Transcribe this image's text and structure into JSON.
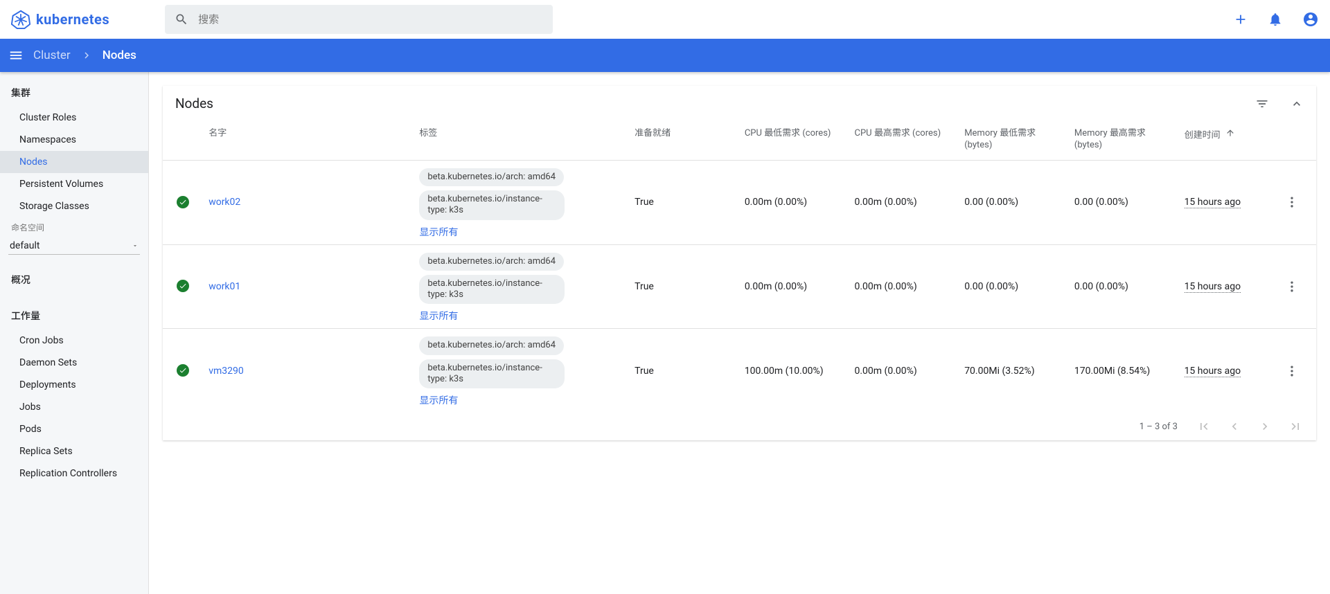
{
  "brand": "kubernetes",
  "search": {
    "placeholder": "搜索"
  },
  "breadcrumb": {
    "root": "Cluster",
    "current": "Nodes"
  },
  "sidebar": {
    "cluster_head": "集群",
    "cluster_items": [
      "Cluster Roles",
      "Namespaces",
      "Nodes",
      "Persistent Volumes",
      "Storage Classes"
    ],
    "cluster_active_index": 2,
    "ns_head": "命名空间",
    "ns_value": "default",
    "overview_head": "概况",
    "workload_head": "工作量",
    "workload_items": [
      "Cron Jobs",
      "Daemon Sets",
      "Deployments",
      "Jobs",
      "Pods",
      "Replica Sets",
      "Replication Controllers"
    ]
  },
  "card": {
    "title": "Nodes",
    "columns": {
      "name": "名字",
      "labels": "标签",
      "ready": "准备就绪",
      "cpu_req": "CPU 最低需求 (cores)",
      "cpu_lim": "CPU 最高需求 (cores)",
      "mem_req": "Memory 最低需求 (bytes)",
      "mem_lim": "Memory 最高需求 (bytes)",
      "created": "创建时间"
    },
    "show_all_label": "显示所有",
    "rows": [
      {
        "name": "work02",
        "labels": [
          "beta.kubernetes.io/arch: amd64",
          "beta.kubernetes.io/instance-type: k3s"
        ],
        "ready": "True",
        "cpu_req": "0.00m (0.00%)",
        "cpu_lim": "0.00m (0.00%)",
        "mem_req": "0.00 (0.00%)",
        "mem_lim": "0.00 (0.00%)",
        "age": "15 hours ago"
      },
      {
        "name": "work01",
        "labels": [
          "beta.kubernetes.io/arch: amd64",
          "beta.kubernetes.io/instance-type: k3s"
        ],
        "ready": "True",
        "cpu_req": "0.00m (0.00%)",
        "cpu_lim": "0.00m (0.00%)",
        "mem_req": "0.00 (0.00%)",
        "mem_lim": "0.00 (0.00%)",
        "age": "15 hours ago"
      },
      {
        "name": "vm3290",
        "labels": [
          "beta.kubernetes.io/arch: amd64",
          "beta.kubernetes.io/instance-type: k3s"
        ],
        "ready": "True",
        "cpu_req": "100.00m (10.00%)",
        "cpu_lim": "0.00m (0.00%)",
        "mem_req": "70.00Mi (3.52%)",
        "mem_lim": "170.00Mi (8.54%)",
        "age": "15 hours ago"
      }
    ],
    "pager": "1 – 3 of 3"
  }
}
